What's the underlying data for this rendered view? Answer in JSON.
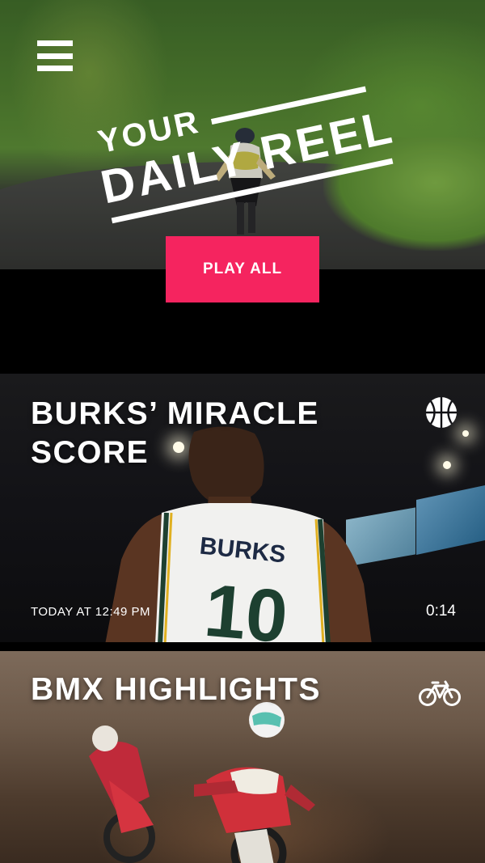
{
  "header": {
    "menu_icon": "hamburger-menu-icon",
    "logo_line_1": "YOUR",
    "logo_line_2": "DAILY REEL"
  },
  "actions": {
    "play_all_label": "PLAY ALL",
    "play_all_color": "#f5245f"
  },
  "reels": [
    {
      "title": "BURKS’ MIRACLE SCORE",
      "icon": "basketball-icon",
      "timestamp": "TODAY AT 12:49 PM",
      "duration": "0:14",
      "jersey_name": "BURKS",
      "jersey_number": "10"
    },
    {
      "title": "BMX HIGHLIGHTS",
      "icon": "bicycle-icon"
    }
  ]
}
